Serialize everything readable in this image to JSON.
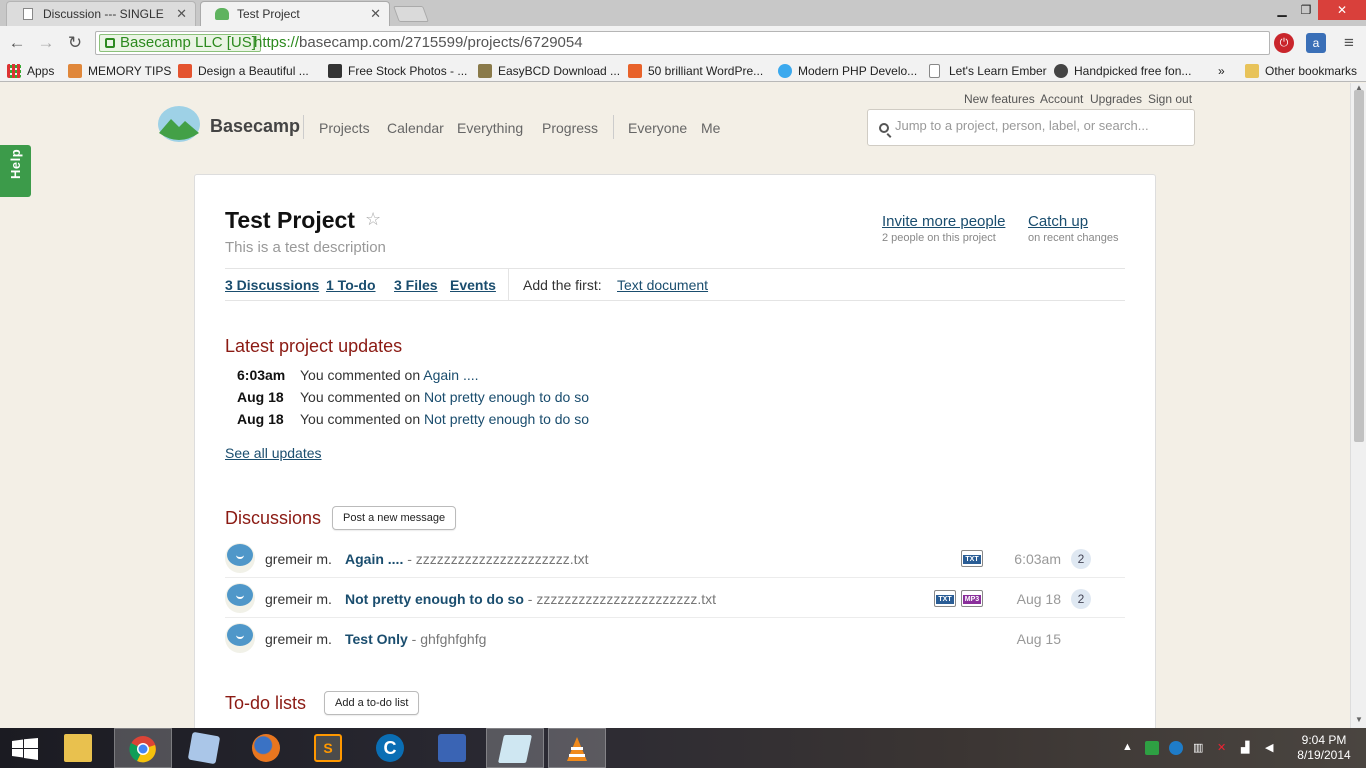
{
  "browser": {
    "tabs": [
      {
        "title": "Discussion --- SINGLE",
        "active": false
      },
      {
        "title": "Test Project",
        "active": true
      }
    ],
    "security_label": "Basecamp LLC [US]",
    "url_protocol": "https://",
    "url_rest": "basecamp.com/2715599/projects/6729054",
    "bookmarks": [
      "Apps",
      "MEMORY TIPS",
      "Design a Beautiful ...",
      "Free Stock Photos - ...",
      "EasyBCD Download ...",
      "50 brilliant WordPre...",
      "Modern PHP Develo...",
      "Let's Learn Ember",
      "Handpicked free fon...",
      "»",
      "Other bookmarks"
    ]
  },
  "help_tab": "Help",
  "top_links": [
    "New features",
    "Account",
    "Upgrades",
    "Sign out"
  ],
  "brand": "Basecamp",
  "nav": [
    "Projects",
    "Calendar",
    "Everything",
    "Progress",
    "Everyone",
    "Me"
  ],
  "search": {
    "placeholder": "Jump to a project, person, label, or search..."
  },
  "project": {
    "title": "Test Project",
    "description": "This is a test description",
    "invite_link": "Invite more people",
    "invite_sub": "2 people on this project",
    "catchup_link": "Catch up",
    "catchup_sub": "on recent changes"
  },
  "subnav": {
    "discussions": "3 Discussions",
    "todo": "1 To-do",
    "files": "3 Files",
    "events": "Events",
    "add_first_label": "Add the first:",
    "add_first_link": "Text document"
  },
  "updates": {
    "heading": "Latest project updates",
    "items": [
      {
        "time": "6:03am",
        "text": "You commented on",
        "link": "Again ...."
      },
      {
        "time": "Aug 18",
        "text": "You commented on",
        "link": "Not pretty enough to do so"
      },
      {
        "time": "Aug 18",
        "text": "You commented on",
        "link": "Not pretty enough to do so"
      }
    ],
    "see_all": "See all updates"
  },
  "discussions": {
    "heading": "Discussions",
    "button": "Post a new message",
    "rows": [
      {
        "author": "gremeir m.",
        "title": "Again ....",
        "excerpt": " - zzzzzzzzzzzzzzzzzzzzzz.txt",
        "date": "6:03am",
        "count": "2",
        "files": [
          "TXT"
        ]
      },
      {
        "author": "gremeir m.",
        "title": "Not pretty enough to do so",
        "excerpt": " - zzzzzzzzzzzzzzzzzzzzzzz.txt",
        "date": "Aug 18",
        "count": "2",
        "files": [
          "TXT",
          "MP3"
        ]
      },
      {
        "author": "gremeir m.",
        "title": "Test Only",
        "excerpt": " - ghfghfghfg",
        "date": "Aug 15",
        "count": "",
        "files": []
      }
    ]
  },
  "todos": {
    "heading": "To-do lists",
    "button": "Add a to-do list"
  },
  "taskbar": {
    "time": "9:04 PM",
    "date": "8/19/2014"
  }
}
